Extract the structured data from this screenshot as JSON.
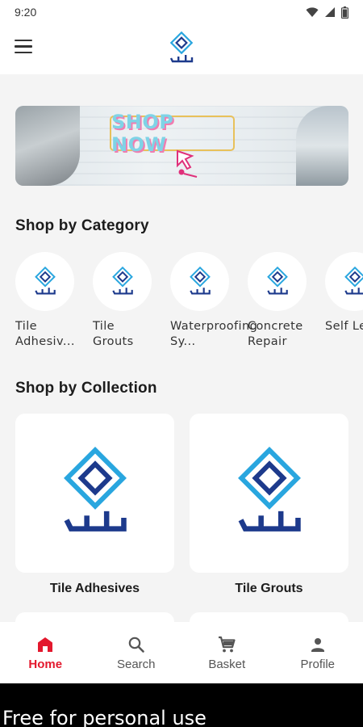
{
  "status_bar": {
    "time": "9:20"
  },
  "header": {
    "logo_icon": "zawaya-logo"
  },
  "banner": {
    "text": "SHOP NOW"
  },
  "categories_section": {
    "title": "Shop by Category",
    "items": [
      {
        "label": "Tile Adhesiv..."
      },
      {
        "label": "Tile Grouts"
      },
      {
        "label": "Waterproofing Sy..."
      },
      {
        "label": "Concrete Repair"
      },
      {
        "label": "Self Leve"
      }
    ]
  },
  "collections_section": {
    "title": "Shop by Collection",
    "items": [
      {
        "label": "Tile Adhesives"
      },
      {
        "label": "Tile Grouts"
      }
    ]
  },
  "bottom_nav": {
    "items": [
      {
        "label": "Home",
        "icon": "home-icon"
      },
      {
        "label": "Search",
        "icon": "search-icon"
      },
      {
        "label": "Basket",
        "icon": "cart-icon"
      },
      {
        "label": "Profile",
        "icon": "person-icon"
      }
    ],
    "active_index": 0
  },
  "watermark": "Free for personal use",
  "colors": {
    "accent": "#e3182d",
    "logo_blue": "#1d3a8c",
    "logo_cyan": "#29a6df"
  }
}
